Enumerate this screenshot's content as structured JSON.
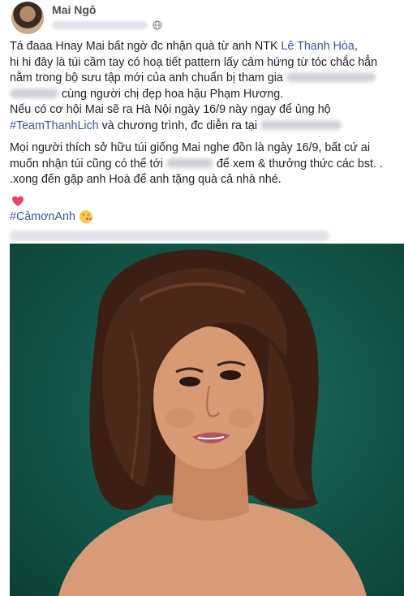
{
  "post": {
    "author": "Mai Ngô",
    "privacy_icon": "globe-icon",
    "paragraph1": {
      "line1_prefix": "Tá đaaa Hnay Mai bất ngờ đc nhận quà từ anh NTK ",
      "line1_link": "Lê Thanh Hòa",
      "line1_suffix": ",",
      "line2": "hi hi đây là túi cầm tay có hoạ tiết pattern lấy cảm hứng từ tóc chắc hẳn",
      "line3": "nằm trong bộ sưu tập mới của anh chuẩn bị tham gia",
      "line4": "cùng người chị đẹp hoa hậu Phạm Hương.",
      "line5": "Nếu có cơ hội Mai sẽ ra Hà Nội ngày 16/9 này ngay để ủng hộ",
      "line6_hashtag": "#TeamThanhLich",
      "line6_text": " và chương trình, đc diễn ra tại"
    },
    "paragraph2": {
      "line1": "Mọi người thích sở hữu túi giống Mai nghe đồn là ngày 16/9, bất cứ ai",
      "line2_prefix": "muốn nhận túi cũng có thể tới",
      "line2_suffix": "để xem & thưởng thức các bst. .",
      "line3": ".xong đến gặp anh Hoà để anh tặng quà cả nhà nhé."
    },
    "emoji_heart": "heart-icon",
    "hashtag2": "#CảmơnAnh",
    "emoji_kiss": "kiss-icon"
  },
  "colors": {
    "link": "#365899",
    "text": "#1d2129",
    "photo_background": "#135448"
  }
}
